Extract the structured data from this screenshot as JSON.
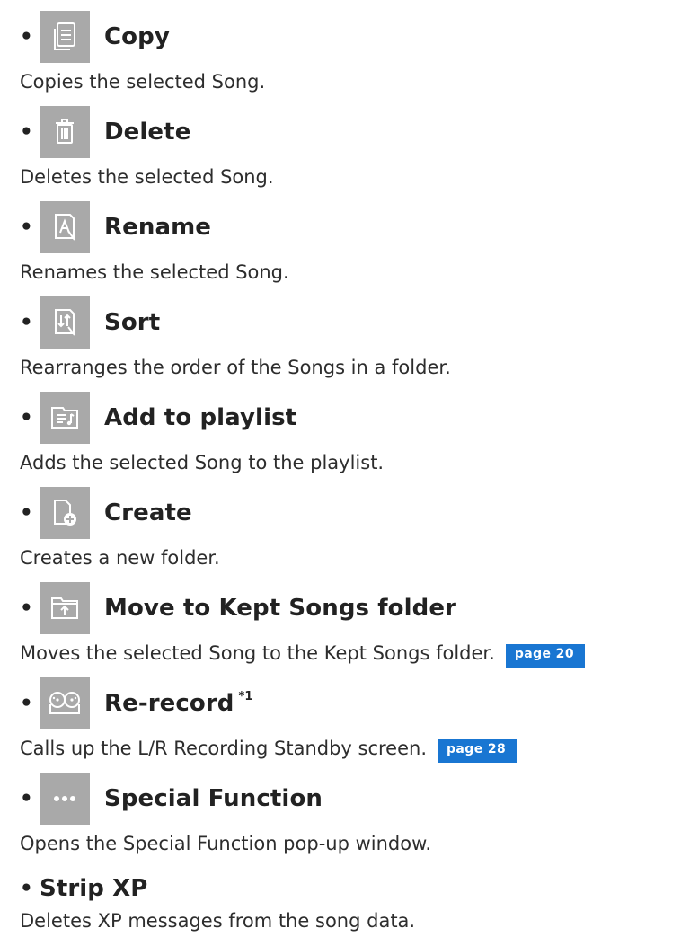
{
  "items": [
    {
      "icon": "copy-icon",
      "title": "Copy",
      "desc": "Copies the selected Song."
    },
    {
      "icon": "trash-icon",
      "title": "Delete",
      "desc": "Deletes the selected Song."
    },
    {
      "icon": "rename-icon",
      "title": "Rename",
      "desc": "Renames the selected Song."
    },
    {
      "icon": "sort-icon",
      "title": "Sort",
      "desc": "Rearranges the order of the Songs in a folder."
    },
    {
      "icon": "add-to-playlist-icon",
      "title": "Add to playlist",
      "desc": "Adds the selected Song to the playlist."
    },
    {
      "icon": "create-folder-icon",
      "title": "Create",
      "desc": "Creates a new folder."
    },
    {
      "icon": "move-to-folder-icon",
      "title": "Move to Kept Songs folder",
      "desc": "Moves the selected Song to the Kept Songs folder.",
      "page_ref": "page 20"
    },
    {
      "icon": "tape-record-icon",
      "title": "Re-record",
      "superscript": "*1",
      "desc": "Calls up the L/R Recording Standby screen.",
      "page_ref": "page 28"
    },
    {
      "icon": "more-dots-icon",
      "title": "Special Function",
      "desc": "Opens the Special Function pop-up window."
    },
    {
      "title": "Strip XP",
      "desc": "Deletes XP messages from the song data."
    }
  ],
  "colors": {
    "icon_background": "#a9a9a9",
    "page_ref_background": "#1976d2",
    "text": "#2a2a2a"
  }
}
